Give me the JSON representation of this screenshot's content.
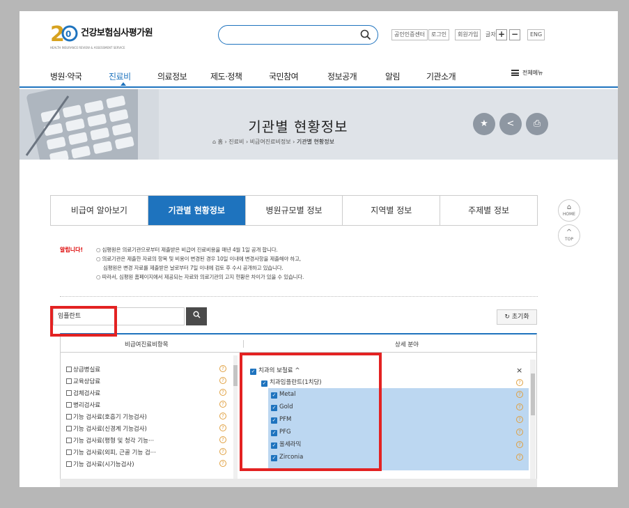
{
  "header": {
    "logo_text": "건강보험심사평가원",
    "logo_sub": "HEALTH INSURANCE REVIEW & ASSESSMENT SERVICE",
    "logo_badge": "20",
    "search_placeholder": "",
    "utilities": [
      "공인인증센터",
      "로그인",
      "회원가입"
    ],
    "font_size_label": "글자",
    "font_plus": "+",
    "font_minus": "−",
    "lang": "ENG"
  },
  "gnb": {
    "items": [
      "병원·약국",
      "진료비",
      "의료정보",
      "제도·정책",
      "국민참여",
      "정보공개",
      "알림",
      "기관소개"
    ],
    "active_index": 1,
    "all_menu": "전체메뉴"
  },
  "banner": {
    "title": "기관별 현황정보",
    "breadcrumb": [
      "홈",
      "진료비",
      "비급여진료비정보",
      "기관별 현황정보"
    ]
  },
  "tabs": [
    "비급여 알아보기",
    "기관별 현황정보",
    "병원규모별 정보",
    "지역별 정보",
    "주제별 정보"
  ],
  "active_tab": 1,
  "side": {
    "home": "HOME",
    "top": "TOP"
  },
  "notice": {
    "label": "알립니다!",
    "lines": [
      "○ 심평원은 의료기관으로부터 제출받은 비급여 진료비용을 매년 4월 1일 공개 합니다.",
      "○ 의료기관은 제출한 자료의 항목 및 비용이 변경된 경우 10일 이내에 변경사항을 제출해야 하고,",
      "심평원은 변경 자료를 제출받은 날로부터 7일 이내에 검토 후 수시 공개하고 있습니다.",
      "○ 따라서, 심평원 홈페이지에서 제공되는 자료와 의료기관의 고지 현황은 차이가 있을 수 있습니다."
    ]
  },
  "keyword": {
    "value": "임플란트",
    "reset": "초기화"
  },
  "table": {
    "col1": "비급여진료비항목",
    "col2": "상세 분야",
    "items": [
      "상급병실료",
      "교육상담료",
      "검체검사료",
      "병리검사료",
      "기능 검사료(호흡기 기능검사)",
      "기능 검사료(신경계 기능검사)",
      "기능 검사료(평형 및 청각 기능···",
      "기능 검사료(외피, 근골 기능 검···",
      "기능 검사료(시기능검사)"
    ],
    "detail_group": "치과의 보철료",
    "detail_sub": "치과임플란트(1치당)",
    "detail_items": [
      "Metal",
      "Gold",
      "PFM",
      "PFG",
      "올세라믹",
      "Zirconia"
    ],
    "close": "×"
  },
  "colors": {
    "accent": "#1e73be",
    "highlight": "#e32222"
  }
}
